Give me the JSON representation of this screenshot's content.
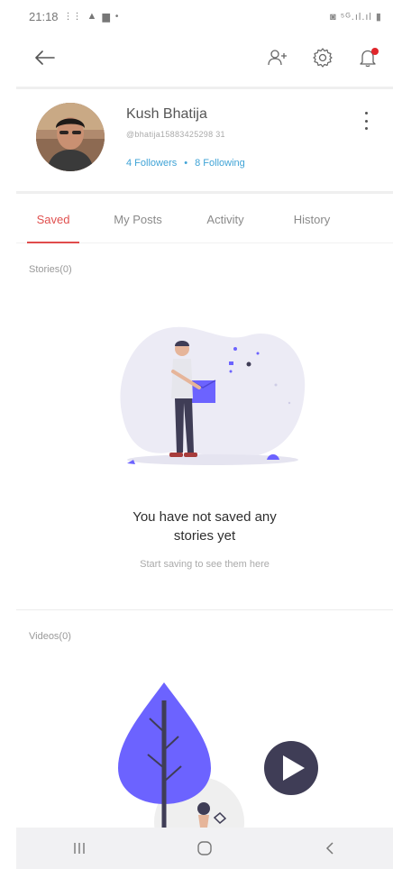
{
  "status_bar": {
    "time": "21:18",
    "left_icons": [
      "notification-icon",
      "warning-icon",
      "image-icon",
      "dot-icon"
    ],
    "right_text": "◙ ⁵ᴳ.ıl.ıl ▮"
  },
  "app_bar": {
    "icons": [
      "back-arrow-icon",
      "add-user-icon",
      "settings-gear-icon",
      "notification-bell-icon"
    ],
    "notification_dot_color": "#e0262b"
  },
  "profile": {
    "name": "Kush Bhatija",
    "handle": "@bhatija15883425298 31",
    "followers": "4 Followers",
    "separator": "•",
    "following": "8 Following"
  },
  "tabs": [
    {
      "label": "Saved",
      "active": true
    },
    {
      "label": "My Posts",
      "active": false
    },
    {
      "label": "Activity",
      "active": false
    },
    {
      "label": "History",
      "active": false
    }
  ],
  "stories": {
    "section_title": "Stories(0)",
    "empty_title_line1": "You have not saved any",
    "empty_title_line2": "stories yet",
    "empty_subtitle": "Start saving to see them here"
  },
  "videos": {
    "section_title": "Videos(0)"
  },
  "nav_bar": {
    "icons": [
      "recents-icon",
      "home-icon",
      "back-nav-icon"
    ]
  },
  "colors": {
    "accent": "#e0504f",
    "link": "#3fa3d6",
    "illustration_purple": "#6c63ff",
    "illustration_dark": "#3f3d56"
  }
}
